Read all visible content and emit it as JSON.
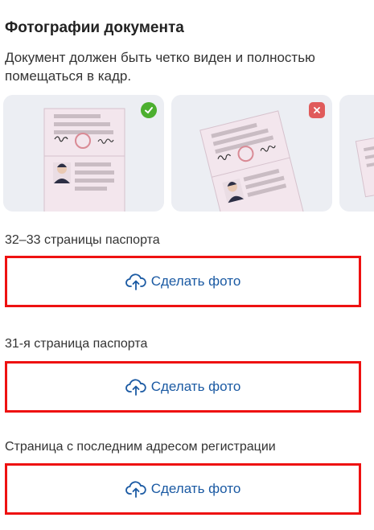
{
  "header": {
    "title": "Фотографии документа",
    "description": "Документ должен быть четко виден и полностью помещаться в кадр."
  },
  "examples": [
    {
      "status": "correct",
      "icon": "check-icon"
    },
    {
      "status": "incorrect",
      "icon": "cross-icon"
    }
  ],
  "sections": [
    {
      "label": "32–33 страницы паспорта",
      "button": "Сделать фото"
    },
    {
      "label": "31-я страница паспорта",
      "button": "Сделать фото"
    },
    {
      "label": "Страница с последним адресом регистрации",
      "button": "Сделать фото"
    }
  ],
  "colors": {
    "accent": "#1b5aa3",
    "highlight_border": "#ee1111",
    "ok": "#4caf2f",
    "bad": "#e05b5b"
  }
}
